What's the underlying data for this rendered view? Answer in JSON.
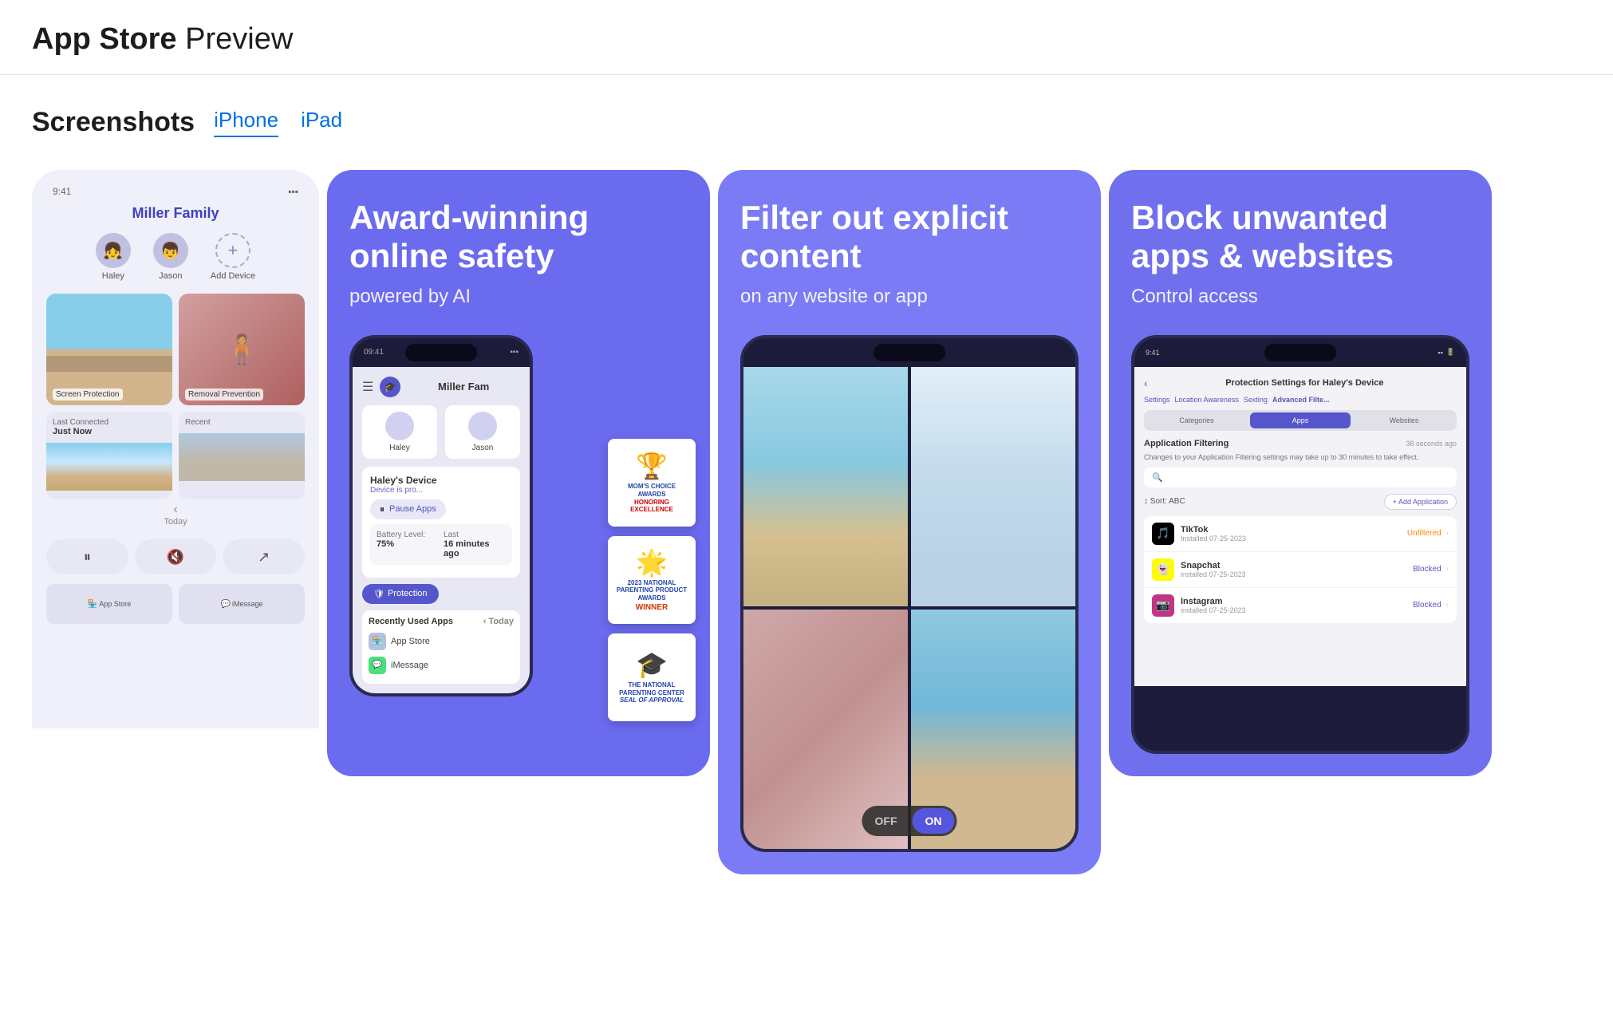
{
  "header": {
    "app_store_label": "App Store",
    "preview_label": "Preview"
  },
  "screenshots_section": {
    "label": "Screenshots",
    "tabs": [
      {
        "id": "iphone",
        "label": "iPhone",
        "active": true
      },
      {
        "id": "ipad",
        "label": "iPad",
        "active": false
      }
    ]
  },
  "cards": [
    {
      "id": "card1",
      "type": "partial_phone",
      "family_name": "Miller Family",
      "members": [
        "Haley",
        "Jason",
        "Add Device"
      ],
      "nav_items": [
        "App Store",
        "iMessage"
      ]
    },
    {
      "id": "card2",
      "headline": "Award-winning online safety",
      "subheadline": "powered by AI",
      "phone": {
        "time": "09:41",
        "family_name": "Miller Fam",
        "members": [
          "Haley",
          "Jason"
        ],
        "device_name": "Haley's Device",
        "device_status": "Device is pro...",
        "pause_label": "Pause Apps",
        "battery": {
          "label": "Battery Level:",
          "value": "75%",
          "last_label": "Last",
          "last_value": "16 minutes ago"
        },
        "protection_label": "Protection",
        "recent_label": "Recently Used Apps",
        "apps": [
          "App Store",
          "iMessage"
        ]
      },
      "awards": [
        {
          "icon": "🏆",
          "title": "Mom's Choice Awards",
          "subtitle": "HONORING EXCELLENCE",
          "color": "#1a44aa"
        },
        {
          "icon": "🌟",
          "title": "2023 National Parenting Product Awards",
          "subtitle": "WINNER",
          "color": "#cc3300"
        },
        {
          "icon": "🎓",
          "title": "The National Parenting Center",
          "subtitle": "Seal of Approval",
          "color": "#2244aa"
        }
      ]
    },
    {
      "id": "card3",
      "headline": "Filter out explicit content",
      "subheadline": "on any website or app",
      "toggle": {
        "off_label": "OFF",
        "on_label": "ON"
      }
    },
    {
      "id": "card4",
      "headline": "Block unwanted apps & websites",
      "subheadline": "Control access",
      "phone": {
        "time": "9:41",
        "page_title": "Protection Settings for Haley's Device",
        "nav_tabs": [
          "Settings",
          "Location Awareness",
          "Sexting",
          "Advanced Filte..."
        ],
        "filter_tabs": [
          "Categories",
          "Apps",
          "Websites"
        ],
        "active_filter_tab": "Apps",
        "section_title": "Application Filtering",
        "timestamp": "38 seconds ago",
        "section_desc": "Changes to your Application Filtering settings may take up to 30 minutes to take effect.",
        "sort_label": "↕ Sort: ABC",
        "add_btn_label": "+ Add Application",
        "apps": [
          {
            "name": "TikTok",
            "icon": "🎵",
            "icon_bg": "#010101",
            "date": "Installed 07-25-2023",
            "status": "Unfiltered",
            "status_type": "unfiltered"
          },
          {
            "name": "Snapchat",
            "icon": "👻",
            "icon_bg": "#FFFC00",
            "date": "installed 07-25-2023",
            "status": "Blocked",
            "status_type": "blocked"
          },
          {
            "name": "Instagram",
            "icon": "📷",
            "icon_bg": "#C13584",
            "date": "installed 07-25-2023",
            "status": "Blocked",
            "status_type": "blocked"
          }
        ]
      }
    }
  ]
}
